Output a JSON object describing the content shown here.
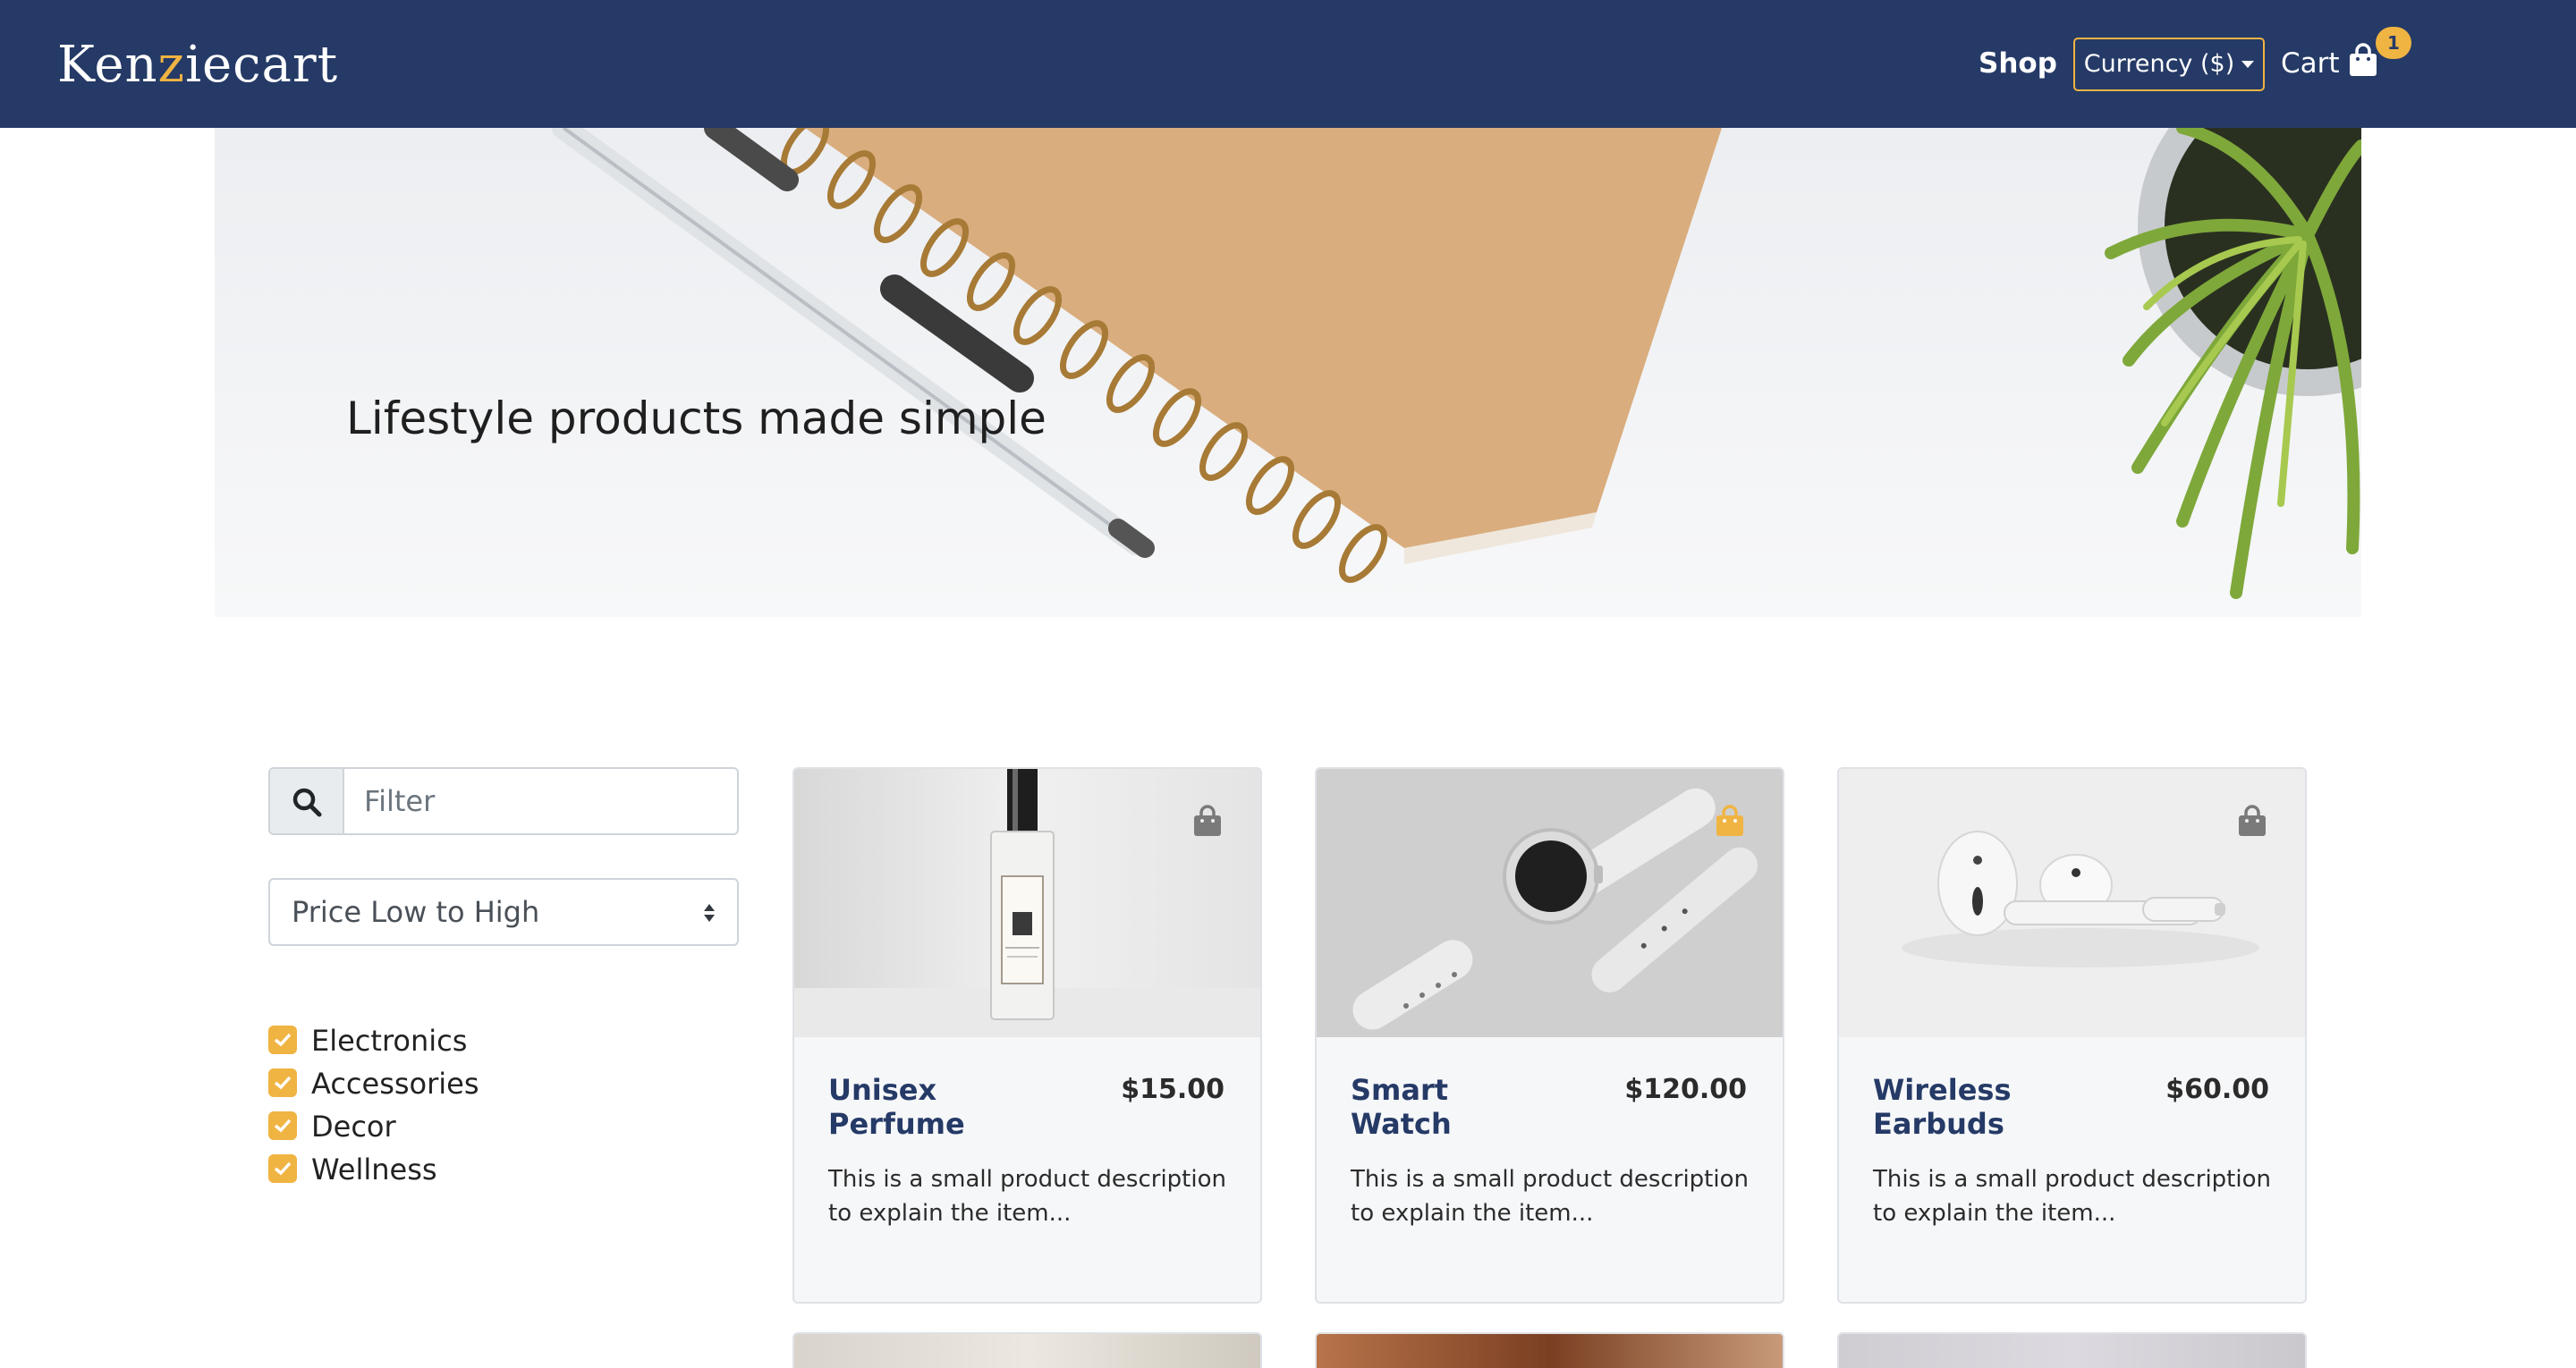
{
  "nav": {
    "brand_main_a": "Ken",
    "brand_arc": "z",
    "brand_main_b": "iecart",
    "shop_label": "Shop",
    "currency_label": "Currency ($)",
    "cart_label": "Cart",
    "cart_count": "1",
    "colors": {
      "navbar": "#253a66",
      "accent": "#f0b443"
    }
  },
  "hero": {
    "title": "Lifestyle products made simple"
  },
  "filters": {
    "search_placeholder": "Filter",
    "sort_selected": "Price Low to High",
    "categories": [
      {
        "label": "Electronics",
        "checked": true
      },
      {
        "label": "Accessories",
        "checked": true
      },
      {
        "label": "Decor",
        "checked": true
      },
      {
        "label": "Wellness",
        "checked": true
      }
    ]
  },
  "products": [
    {
      "name_line1": "Unisex",
      "name_line2": "Perfume",
      "price": "$15.00",
      "description": "This is a small product description to explain the item...",
      "in_cart": false,
      "image": "perfume-bottle"
    },
    {
      "name_line1": "Smart",
      "name_line2": "Watch",
      "price": "$120.00",
      "description": "This is a small product description to explain the item...",
      "in_cart": true,
      "image": "smart-watch"
    },
    {
      "name_line1": "Wireless",
      "name_line2": "Earbuds",
      "price": "$60.00",
      "description": "This is a small product description to explain the item...",
      "in_cart": false,
      "image": "wireless-earbuds"
    }
  ]
}
